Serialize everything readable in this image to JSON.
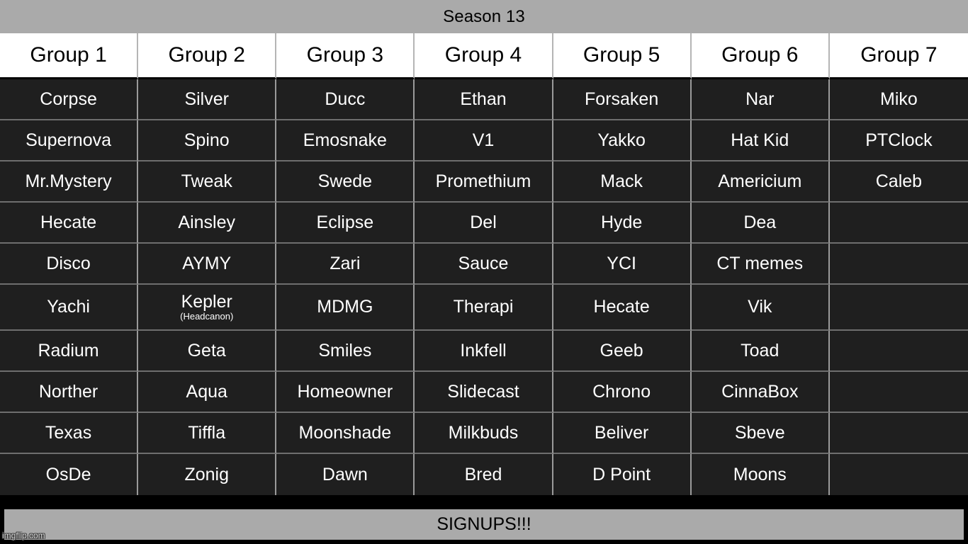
{
  "title": "Season 13",
  "footer": {
    "banner_label": "SIGNUPS!!!"
  },
  "watermark": "imgflip.com",
  "colors": {
    "title_bar_bg": "#aaaaaa",
    "header_bg": "#ffffff",
    "header_text": "#000000",
    "cell_bg": "#1f1f1f",
    "cell_text": "#ffffff",
    "page_bg": "#000000",
    "cell_border": "#9a9a9a",
    "banner_bg": "#aaaaaa"
  },
  "table": {
    "headers": [
      "Group 1",
      "Group 2",
      "Group 3",
      "Group 4",
      "Group 5",
      "Group 6",
      "Group 7"
    ],
    "rows": [
      [
        "Corpse",
        "Silver",
        "Ducc",
        "Ethan",
        "Forsaken",
        "Nar",
        "Miko"
      ],
      [
        "Supernova",
        "Spino",
        "Emosnake",
        "V1",
        "Yakko",
        "Hat Kid",
        "PTClock"
      ],
      [
        "Mr.Mystery",
        "Tweak",
        "Swede",
        "Promethium",
        "Mack",
        "Americium",
        "Caleb"
      ],
      [
        "Hecate",
        "Ainsley",
        "Eclipse",
        "Del",
        "Hyde",
        "Dea",
        ""
      ],
      [
        "Disco",
        "AYMY",
        "Zari",
        "Sauce",
        "YCI",
        "CT memes",
        ""
      ],
      [
        "Yachi",
        "Kepler",
        "MDMG",
        "Therapi",
        "Hecate",
        "Vik",
        ""
      ],
      [
        "Radium",
        "Geta",
        "Smiles",
        "Inkfell",
        "Geeb",
        "Toad",
        ""
      ],
      [
        "Norther",
        "Aqua",
        "Homeowner",
        "Slidecast",
        "Chrono",
        "CinnaBox",
        ""
      ],
      [
        "Texas",
        "Tiffla",
        "Moonshade",
        "Milkbuds",
        "Beliver",
        "Sbeve",
        ""
      ],
      [
        "OsDe",
        "Zonig",
        "Dawn",
        "Bred",
        "D Point",
        "Moons",
        ""
      ]
    ],
    "annotations": {
      "kepler_subtitle": "(Headcanon)"
    }
  }
}
